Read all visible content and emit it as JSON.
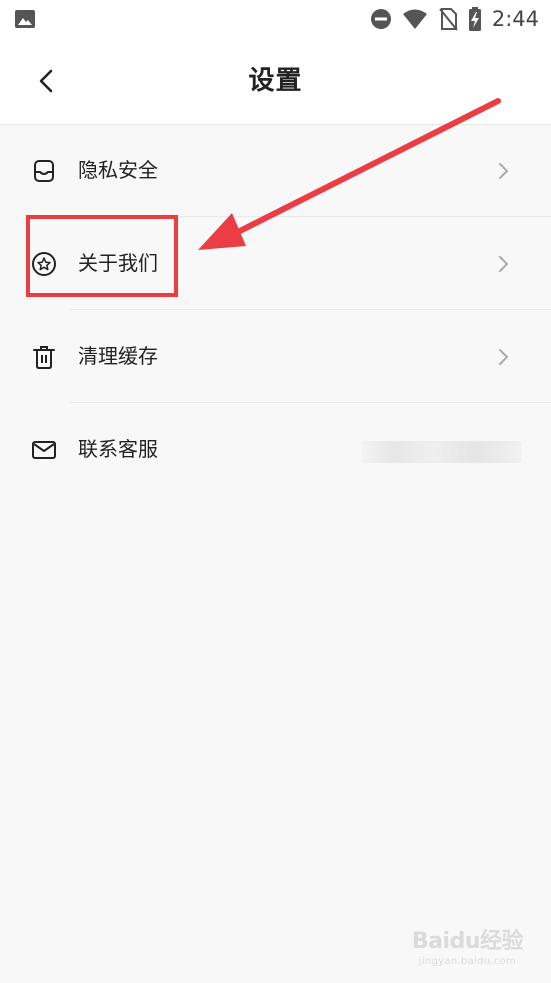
{
  "status_bar": {
    "time": "2:44",
    "left_icon": "image-icon",
    "right_icons": [
      "do-not-disturb-icon",
      "wifi-icon",
      "no-sim-icon",
      "battery-charging-icon"
    ]
  },
  "header": {
    "title": "设置",
    "back_icon": "chevron-left-icon"
  },
  "menu": {
    "items": [
      {
        "label": "隐私安全",
        "icon": "privacy-icon",
        "chevron": true
      },
      {
        "label": "关于我们",
        "icon": "star-circle-icon",
        "chevron": true
      },
      {
        "label": "清理缓存",
        "icon": "trash-icon",
        "chevron": true
      },
      {
        "label": "联系客服",
        "icon": "mail-icon",
        "chevron": false,
        "value_blurred": true
      }
    ]
  },
  "annotation": {
    "highlight_color": "#ea3d44",
    "highlighted_item": "关于我们"
  },
  "watermark": {
    "main": "Baidu经验",
    "sub": "jingyan.baidu.com"
  }
}
